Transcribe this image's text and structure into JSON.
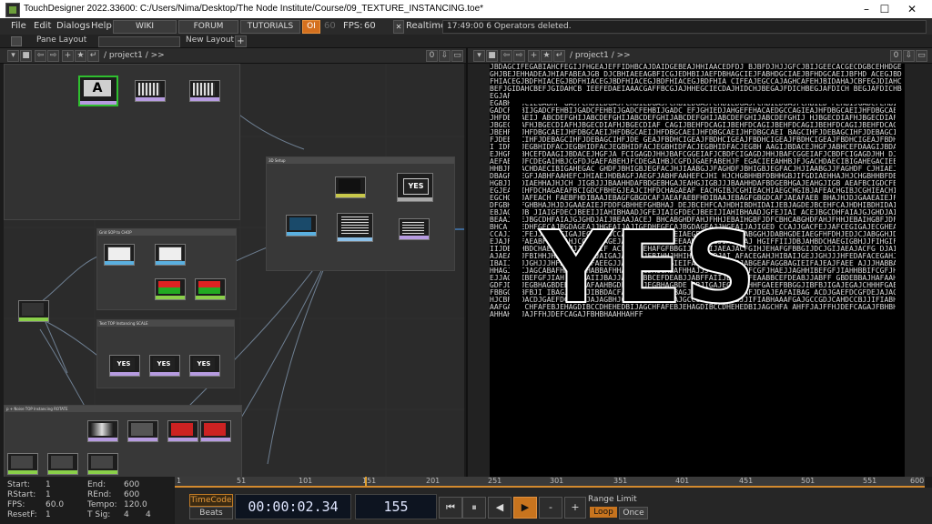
{
  "window": {
    "title": "TouchDesigner 2022.33600: C:/Users/Nima/Desktop/The Node Institute/Course/09_TEXTURE_INSTANCING.toe*",
    "minimize": "–",
    "maximize": "☐",
    "close": "✕"
  },
  "menu": {
    "items": [
      "File",
      "Edit",
      "Dialogs",
      "Help"
    ],
    "wiki": "WIKI",
    "forum": "FORUM",
    "tutorials": "TUTORIALS",
    "oi": "OI",
    "fps_dim": "60",
    "fps_label": "FPS:",
    "fps_value": "60",
    "realtime_check": "✕",
    "realtime": "Realtime",
    "status": "17:49:00 6 Operators deleted."
  },
  "layoutbar": {
    "pane_layout": "Pane Layout",
    "new_layout": "New Layout",
    "plus": "+"
  },
  "left_pane": {
    "path": "/ project1 / >>",
    "counter": "0"
  },
  "right_pane": {
    "path": "/ project1 / >>",
    "counter": "0"
  },
  "network": {
    "box_3d_setup": "3D Setup",
    "box_grid": "Grid SOP to CHOP",
    "box_text": "Text TOP Instancing SCALE",
    "box_noise": "p + Noise TOP Instancing ROTATE",
    "node_text_a": "A",
    "node_yes": "YES"
  },
  "viewer": {
    "yes_text": "YES",
    "chars": "JBDAGCIFEGABIAHCFEGIJFHGEAJEFFIDHBCAJDAIDGEBEAJHHIAACEDFDJ BJBFDJHJJGFCJBIJGEECACGECDGBCEHHDGEGHJBEJEHHADEAJHIAFABEAJGB DJCBHIAEEAGBFICGJEDHBIJAEFDBHAGCIEJFABHDGCIAEJBFHDGCAEIJBFHD ACEGJBDFHIACEGJBDFHIACEGJBDFHIACEGJBDFHIACEGJBDFHIACEGJBDFHIA CIFEAJEGCCAJAGHCAFEHJBIDAHAJCBFEGJDIAHCBEFJGIDAHCBEFJGIDAHCB IEEFEDAEIAAACGAFFBCGJAJHHEGCIECDAJHIDCHJBEGAJFDICHBEGJAFDICH BEGJAFDICHBEGJAFDICHBEGJAFDICHBEGJAFDICHBEGJAFDICHBEGJAFDICH DJCIEGABHFDJCIEGABHFDJCIEGABHFDJCIEGABHFDJCIEGABHFDJCIEGABHF GAJFCHBIEDGAJFCHBIEDGAJFCHBIEDGAJFCHBIEDGAJFCHBIEDGAJFCHBIED FEHBIJGADCFEHBIJGADCFEHBIJGADCFEHBIJGADCFEHBIJGADCFEHBIJGADC EFJGHIEDJAHGEFEHACAEDGCCAGIEAJHFDBGCAEIJHFDBGCAEIJHFDBGCAEIJ ABCDEFGHIJABCDEFGHIJABCDEFGHIJABCDEFGHIJABCDEFGHIJABCDEFGHIJ HJBGECDIAFHJBGECDIAFHJBGECDIAFHJBGECDIAFHJBGECDIAFHJBGECDIAF CAGIJBEHFDCAGIJBEHFDCAGIJBEHFDCAGIJBEHFDCAGIJBEHFDCAGIJBEHFD JHFDBGCAEIJHFDBGCAEIJHFDBGCAEIJHFDBGCAEIJHFDBGCAEIJHFDBGCAEI BAGCIHFJDEBAGCIHFJDEBAGCIHFJDEBAGCIHFJDEBAGCIHFJDEBAGCIHFJDE GEAJFBDHCIGEAJFBDHCIGEAJFBDHCIGEAJFBDHCIGEAJFBDHCIGEAJFBDHCI IDFACJEGBHIDFACJEGBHIDFACJEGBHIDFACJEGBHIDFACJEGBHIDFACJEGBH AAGIJBDACEJHGFJABHCEFDAAGIJBDACEJHGFJABHCEFDAAGIJBDACEJHGFJA FCIGAGDJHHJBAFCGGEIAFJCBDFCIGAGDJHHJBAFCGGEIAFJCBDFCIGAGDJHH DJGAEFABEHJFCDEGAIHBJCGFDJGAEFABEHJFCDEGAIHBJCGFDJGAEFABEHJF EGACIEEAHHBJFJGACHDAECIBIGAHEGACIEEAHHBJFJGACHDAECIBIGAHEGAC GHDFJBHIGBJEGFACJHJIAABGJJFAGHDFJBHIGBJEGFACJHJIAABGJJFAGHDF CJHIAEJHDBAGFJAEGFJABHFAAHEFCJHIAEJHDBAGFJAEGFJABHFAAHEFCJHI HJCHGBHHBFDBHHGBJIFGDIAEHHAJHJCHGBHHBFDBHHGBJIFGDIAEHHAJHJCH JIGBJJJBAAHHDAFBDGEBHGAJEAHGJIGBJJJBAAHHDAFBDGEBHGAJEAHGJIGB AEAFBCIGDCFBHEGJEAJCIHFDCHAGAEAFBCIGDCFBHEGJEAJCIHFDCHAGAEAF EACHGIBJCGHIEACHIAEGCHGIBJAFEACHGIBJCGHIEACHIAEGCHGIBJAFEACH FAEBFHDIBAAJEBAGFGBGDCAFJAEAFAEBFHDIBAAJEBAGFGBGDCAFJAEAFAEB BHAJHJDJGAAEAIEJFDDFGBHHEFGHBHAJHJDJGAAEAIEJFDDFGBHHEFGHBHAJ DEJBCEHFCAJHDHIBDHIDAIJEBJAGDEJBCEHFCAJHDHIBDHIDAIJEBJAGDEJB JIAIGFDECJBEEIJIAHIBHAADJGFEJIAIGFDECJBEEIJIAHIBHAADJGFEJIAI ACEJBGCDHFAIAJGJGHDJAIJBEAAJACEJBGCDHFAIAJGJGHDJAIJBEAAJACEJ BHCABGHDFAHJFHHJEBAIHGBFJDFCBHCABGHDFAHJFHHJEBAIHGBFJDFCBHCA IGEDHFGECAJBGDAGEAJJHGEAIJAJIGEDHFGECAJBGDAGEAJJHGEAIJAJIGED CCAJJGACFEJJAFCEGIGAJECGHEAJCCAJJGACFEJJAFCEGIGAJECGHEAJCCAJ GHJDABHGDEIAEGFHFDHJEDJCJABGGHJDABHGDEIAEGFHFDHJEDJCJABGGHJD EJAJFAJFAEABFHEEAAHJCCAGJIAGEJAJFAJFAEABFHEEAAHJCCAGJIAGEJAJ HGIFFIIJDBJAHBDCHAEGIGBHJJFIHGIFFIIJDBJAHBDCHAEGIGBHJJFIHGIF ACFGIHJEHAFGFBBGIJDCJGIJAEAJACFGIHJEHAFGFBBGIJDCJGIJAEAJACFG DJAIGAJAEAHCJFBIHHJHHIHJAJHFDJAIGAJAEAHCJFBIHHJHHIHJAJHFDJAI AFACEGAHJHIBAIJGEJJGHJJJHFEDAFACEGAHJHIBAIJGEJJGHJJJHFEDAFAC FAEEGJJABGEAFAGGBAGIEIFAJEAJFAEEGJJABGEAFAGGBAGIEIFAJEAJFAEE AJJJHABBAFHHAGJEGCJAGCABAFHHAJJJHABBAFHHAGJEGCJAGCABAFHHAJJJ JIAHHBBIFCGFJHAEJJAGHHIBEFGFJIAHHBBIFCGFJHAEJJAGHHIBEFGFJIAH ABFFAIIJBAJJAFEAABBCEFDEABJJABFFAIIJBAJJAFEAABBCEFDEABJJABFF GBDEBBAJHAFAAHBGDFJDIHJEGBHAGBDEBBAJHAFAAHBGDFJDIHJEGBHAGBDE FBJIGAJEGAJCHHHFGAEEFBBGGJIBFBJIGAJEGAJCHHHFGAEEFBBGGJIBFBJI IBAGJACAJJIBBDACFAFJDEAJEAFAIBAGJACAJJIBBDACFAFJDEAJEAFAIBAG ACDJGAEFDCGFDEJAJAGBHJCBFHHDACDJGAEFDCGFDEJAJAGBHJCBFHHDACDJ GAJGCCGDJCAHDCCBJJIFIABHAAAFGAJGCCGDJCAHDCCBJJIFIABHAAAFGAJG CHFAFEBJEHAGDIBCCDHEHEDBIJAGCHFAFEBJEHAGDIBCCDHEHEDBIJAGCHFA AHFFJAJFFHJDEFCAGAJFBHBHAAHHAHFFJAJFFHJDEFCAGAJFBHBHAAHHAHFF"
  },
  "timeline": {
    "ticks": [
      "1",
      "51",
      "101",
      "151",
      "201",
      "251",
      "301",
      "351",
      "401",
      "451",
      "501",
      "551",
      "600"
    ],
    "current_marker": "1"
  },
  "stats": {
    "start_label": "Start:",
    "start_value": "1",
    "rstart_label": "RStart:",
    "rstart_value": "1",
    "fps_label": "FPS:",
    "fps_value": "60.0",
    "resetf_label": "ResetF:",
    "resetf_value": "1",
    "end_label": "End:",
    "end_value": "600",
    "rend_label": "REnd:",
    "rend_value": "600",
    "tempo_label": "Tempo:",
    "tempo_value": "120.0",
    "tsig_label": "T Sig:",
    "tsig_value_a": "4",
    "tsig_value_b": "4"
  },
  "transport": {
    "timecode_btn": "TimeCode",
    "beats_btn": "Beats",
    "timecode": "00:00:02.34",
    "frame": "155",
    "first": "⏮",
    "pause": "⏸",
    "back": "◀",
    "play": "▶",
    "minus": "-",
    "plus": "+",
    "range_limit": "Range Limit",
    "loop": "Loop",
    "once": "Once"
  }
}
